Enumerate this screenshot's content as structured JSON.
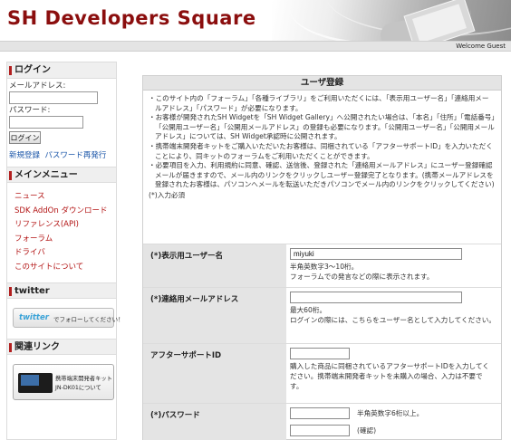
{
  "header": {
    "site_title": "SH Developers Square",
    "welcome": "Welcome Guest"
  },
  "sidebar": {
    "login": {
      "heading": "ログイン",
      "email_label": "メールアドレス:",
      "password_label": "パスワード:",
      "login_button": "ログイン",
      "register_link": "新規登録",
      "reissue_link": "パスワード再発行"
    },
    "menu": {
      "heading": "メインメニュー",
      "items": [
        "ニュース",
        "SDK AddOn ダウンロード",
        "リファレンス(API)",
        "フォーラム",
        "ドライバ",
        "このサイトについて"
      ]
    },
    "twitter": {
      "heading": "twitter",
      "logo": "twitter",
      "text": "でフォローしてください！"
    },
    "related": {
      "heading": "関連リンク",
      "banner_line1": "携帯端末開発者キット",
      "banner_line2": "JN-DK01について"
    }
  },
  "main": {
    "title": "ユーザ登録",
    "intro": [
      "・このサイト内の「フォーラム」「各種ライブラリ」をご利用いただくには、「表示用ユーザー名」「連絡用メールアドレス」「パスワード」が必要になります。",
      "・お客様が開発されたSH Widgetを「SH Widget Gallery」へ公開されたい場合は、「本名」「住所」「電話番号」「公開用ユーザー名」「公開用メールアドレス」の登録も必要になります。「公開用ユーザー名」「公開用メールアドレス」については、SH Widget承認時に公開されます。",
      "・携帯端末開発者キットをご購入いただいたお客様は、同梱されている「アフターサポートID」を入力いただくことにより、同キットのフォーラムをご利用いただくことができます。",
      "・必要項目を入力、利用規約に同意、確認、送信後、登録された「連絡用メールアドレス」にユーザー登録確認メールが届きますので、メール内のリンクをクリックしユーザー登録完了となります。(携帯メールアドレスを登録されたお客様は、パソコンへメールを転送いただきパソコンでメール内のリンクをクリックしてください)"
    ],
    "required_note": "(*)入力必須",
    "fields": {
      "display_name": {
        "label": "(*)表示用ユーザー名",
        "value": "miyuki",
        "hint1": "半角英数字3～10桁。",
        "hint2": "フォーラムでの発言などの際に表示されます。"
      },
      "email": {
        "label": "(*)連絡用メールアドレス",
        "value": "",
        "hint1": "最大60桁。",
        "hint2": "ログインの際には、こちらをユーザー名として入力してください。"
      },
      "support_id": {
        "label": "アフターサポートID",
        "value": "",
        "hint": "購入した商品に同梱されているアフターサポートIDを入力してください。携帯端末開発者キットを未購入の場合、入力は不要です。"
      },
      "password": {
        "label": "(*)パスワード",
        "value": "",
        "hint": "半角英数字6桁以上。",
        "confirm_value": "",
        "confirm_hint": "(確認)"
      }
    }
  },
  "colors": {
    "brand": "#8b0e0e",
    "accent_red": "#b31515",
    "link_blue": "#1a55a8",
    "label_bg": "#e4e4e4"
  }
}
